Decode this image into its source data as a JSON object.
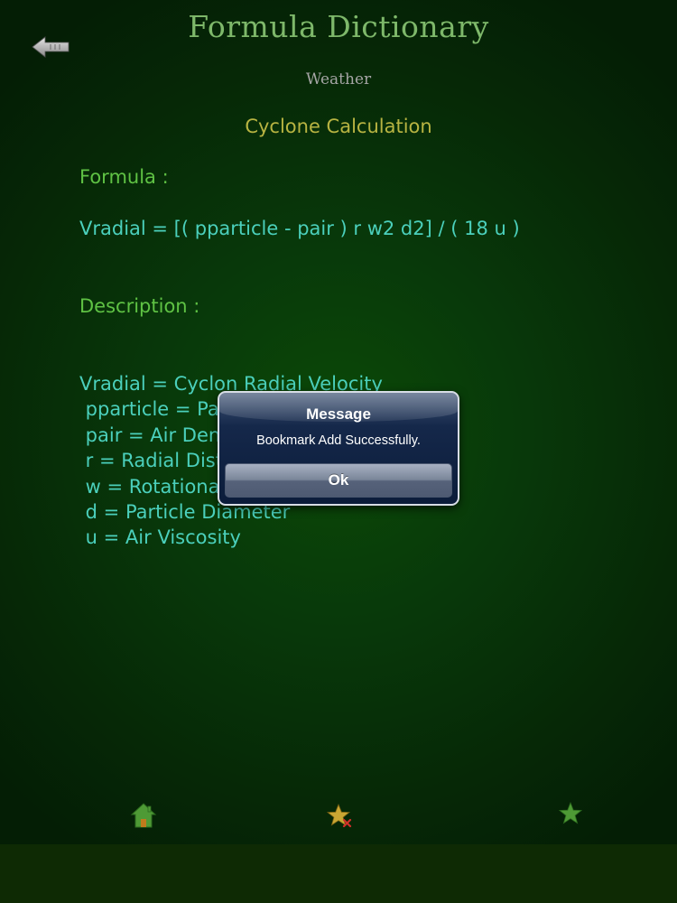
{
  "header": {
    "title": "Formula Dictionary",
    "back_icon": "back-arrow-icon"
  },
  "category": "Weather",
  "calculation": {
    "title": "Cyclone Calculation",
    "formula_label": "Formula :",
    "formula": "Vradial = [( pparticle - pair ) r w2 d2] / ( 18 u )",
    "description_label": "Description :",
    "description_lines": [
      "Vradial = Cyclon Radial Velocity",
      " pparticle = Particle Density",
      " pair = Air Density",
      " r = Radial Distance",
      " w = Rotational Velocity",
      " d = Particle Diameter",
      " u = Air Viscosity"
    ]
  },
  "alert": {
    "title": "Message",
    "message": "Bookmark Add Successfully.",
    "ok_label": "Ok"
  },
  "bottom_bar": {
    "icons": [
      "home-icon",
      "add-bookmark-star-icon",
      "bookmarks-star-icon"
    ]
  },
  "colors": {
    "title": "#7eb86a",
    "calc_title": "#b8b442",
    "label": "#5fc244",
    "body_text": "#4bd0bc",
    "background": "#08380a"
  }
}
